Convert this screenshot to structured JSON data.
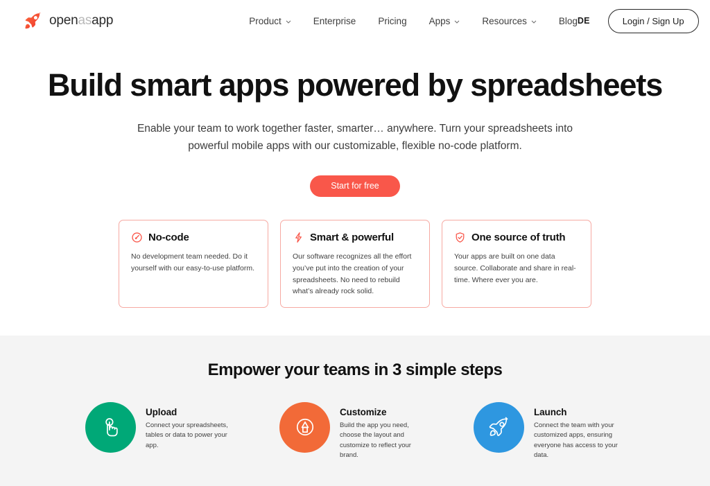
{
  "brand": {
    "icon": "rocket-logo-icon",
    "text_segments": [
      {
        "text": "open",
        "tone": "dark"
      },
      {
        "text": "as",
        "tone": "light"
      },
      {
        "text": "app",
        "tone": "dark"
      }
    ],
    "full_text": "openasapp"
  },
  "nav": {
    "items": [
      {
        "label": "Product",
        "has_dropdown": true
      },
      {
        "label": "Enterprise",
        "has_dropdown": false
      },
      {
        "label": "Pricing",
        "has_dropdown": false
      },
      {
        "label": "Apps",
        "has_dropdown": true
      },
      {
        "label": "Resources",
        "has_dropdown": true
      },
      {
        "label": "Blog",
        "has_dropdown": false
      }
    ],
    "language": "DE",
    "login_label": "Login / Sign Up"
  },
  "hero": {
    "title": "Build smart apps powered by spreadsheets",
    "subtitle": "Enable your team to work together faster, smarter… anywhere. Turn your spreadsheets into powerful mobile apps with our customizable, flexible no-code platform.",
    "cta_label": "Start for free",
    "cta_color": "#f9574a"
  },
  "features": {
    "cards": [
      {
        "icon": "gauge-icon",
        "title": "No-code",
        "body": "No development team needed. Do it yourself with our easy-to-use platform."
      },
      {
        "icon": "lightning-bolt-icon",
        "title": "Smart & powerful",
        "body": "Our software recognizes all the effort you’ve put into the creation of your spreadsheets. No need to rebuild what’s already rock solid."
      },
      {
        "icon": "shield-check-icon",
        "title": "One source of truth",
        "body": "Your apps are built on one data source. Collaborate and share in real-time. Where ever you are."
      }
    ],
    "border_color": "#f6a9a2",
    "icon_color": "#f9574a"
  },
  "steps_section": {
    "title": "Empower your teams in 3 simple steps",
    "background": "#f4f4f4",
    "steps": [
      {
        "icon": "hand-click-icon",
        "color": "#00a877",
        "name": "Upload",
        "desc": "Connect your spreadsheets, tables or data to power your app."
      },
      {
        "icon": "brand-palette-icon",
        "color": "#f26a38",
        "name": "Customize",
        "desc": "Build the app you need, choose the layout and customize to reflect your brand."
      },
      {
        "icon": "rocket-icon",
        "color": "#2e97e0",
        "name": "Launch",
        "desc": "Connect the team with your customized apps, ensuring everyone has access to your data."
      }
    ]
  }
}
